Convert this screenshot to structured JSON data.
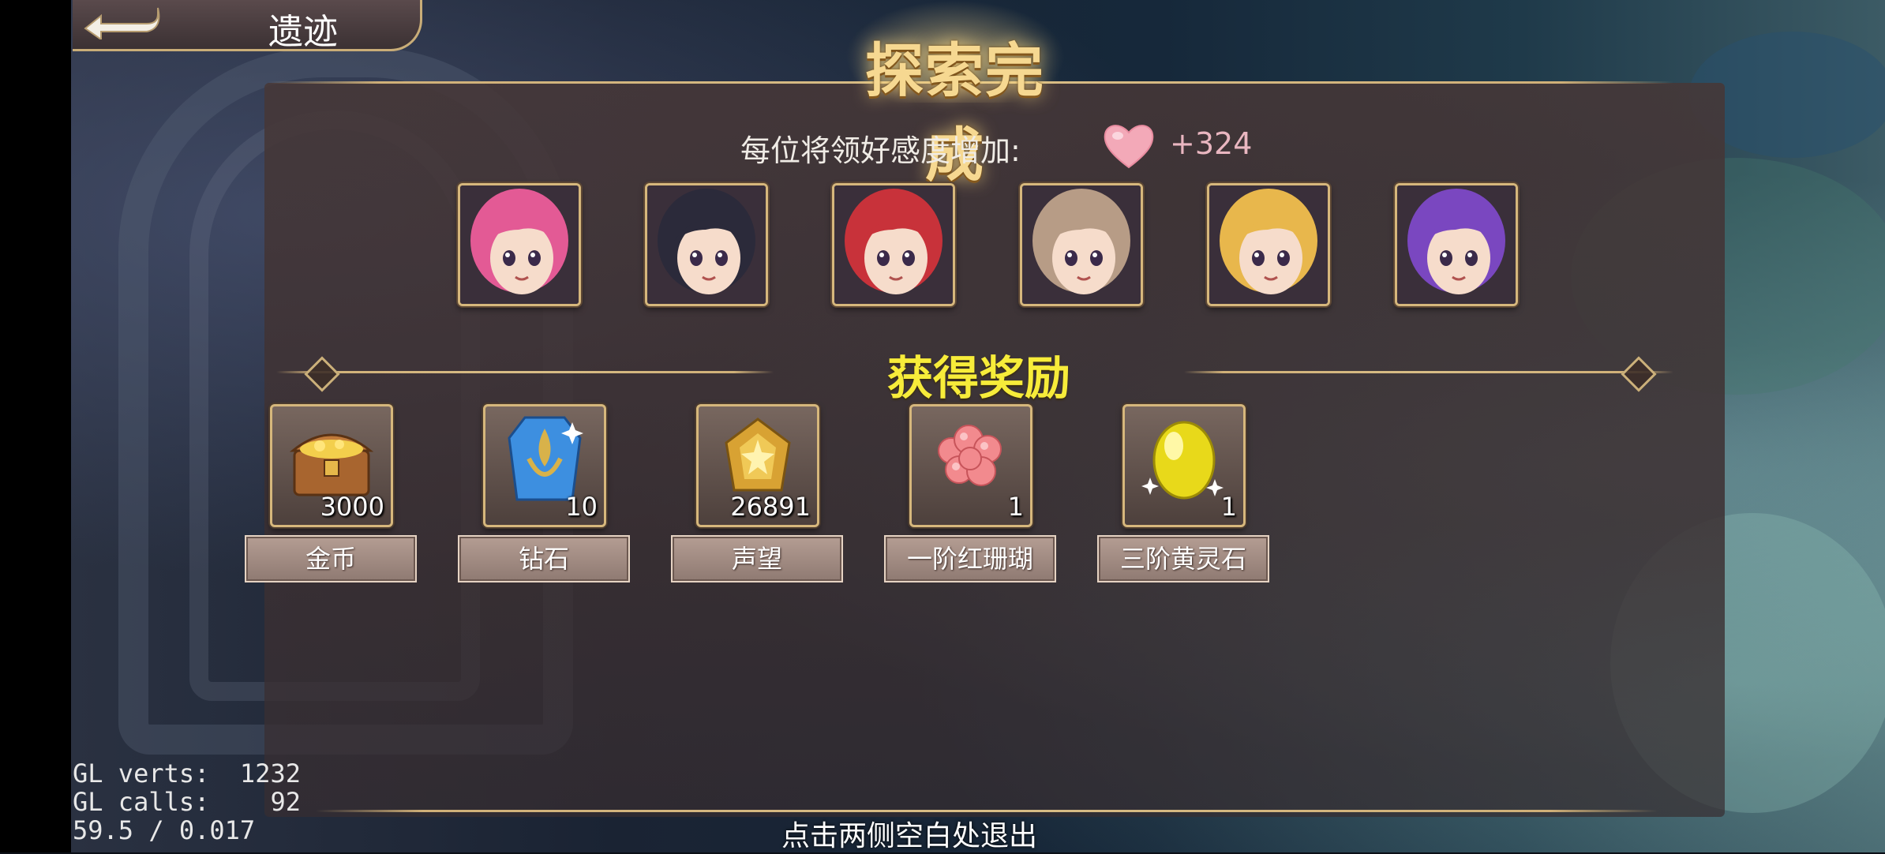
{
  "header": {
    "back_icon": "back-arrow-icon",
    "location_title": "遗迹",
    "main_title": "探索完成"
  },
  "affection": {
    "label": "每位将领好感度增加:",
    "icon": "heart-icon",
    "icon_color": "#f3a9b8",
    "value": "+324"
  },
  "generals": [
    {
      "name": "pink-hair-maid",
      "hair": "#e35a95"
    },
    {
      "name": "dark-hair-cap",
      "hair": "#2b2a3a"
    },
    {
      "name": "red-hair-headset",
      "hair": "#c8323a"
    },
    {
      "name": "brown-hair-mask",
      "hair": "#b79c86"
    },
    {
      "name": "blonde-hair",
      "hair": "#e8b74c"
    },
    {
      "name": "purple-hair-flower",
      "hair": "#7a47c0"
    }
  ],
  "rewards_title": "获得奖励",
  "rewards": [
    {
      "icon": "treasure-chest-icon",
      "qty": "3000",
      "label": "金币"
    },
    {
      "icon": "blue-diamond-crystal-icon",
      "qty": "10",
      "label": "钻石"
    },
    {
      "icon": "gold-prestige-medal-icon",
      "qty": "26891",
      "label": "声望"
    },
    {
      "icon": "red-coral-icon",
      "qty": "1",
      "label": "一阶红珊瑚"
    },
    {
      "icon": "yellow-spirit-stone-icon",
      "qty": "1",
      "label": "三阶黄灵石"
    }
  ],
  "exit_hint": "点击两侧空白处退出",
  "debug": {
    "line1": "GL verts:  1232",
    "line2": "GL calls:    92",
    "line3": "59.5 / 0.017"
  }
}
